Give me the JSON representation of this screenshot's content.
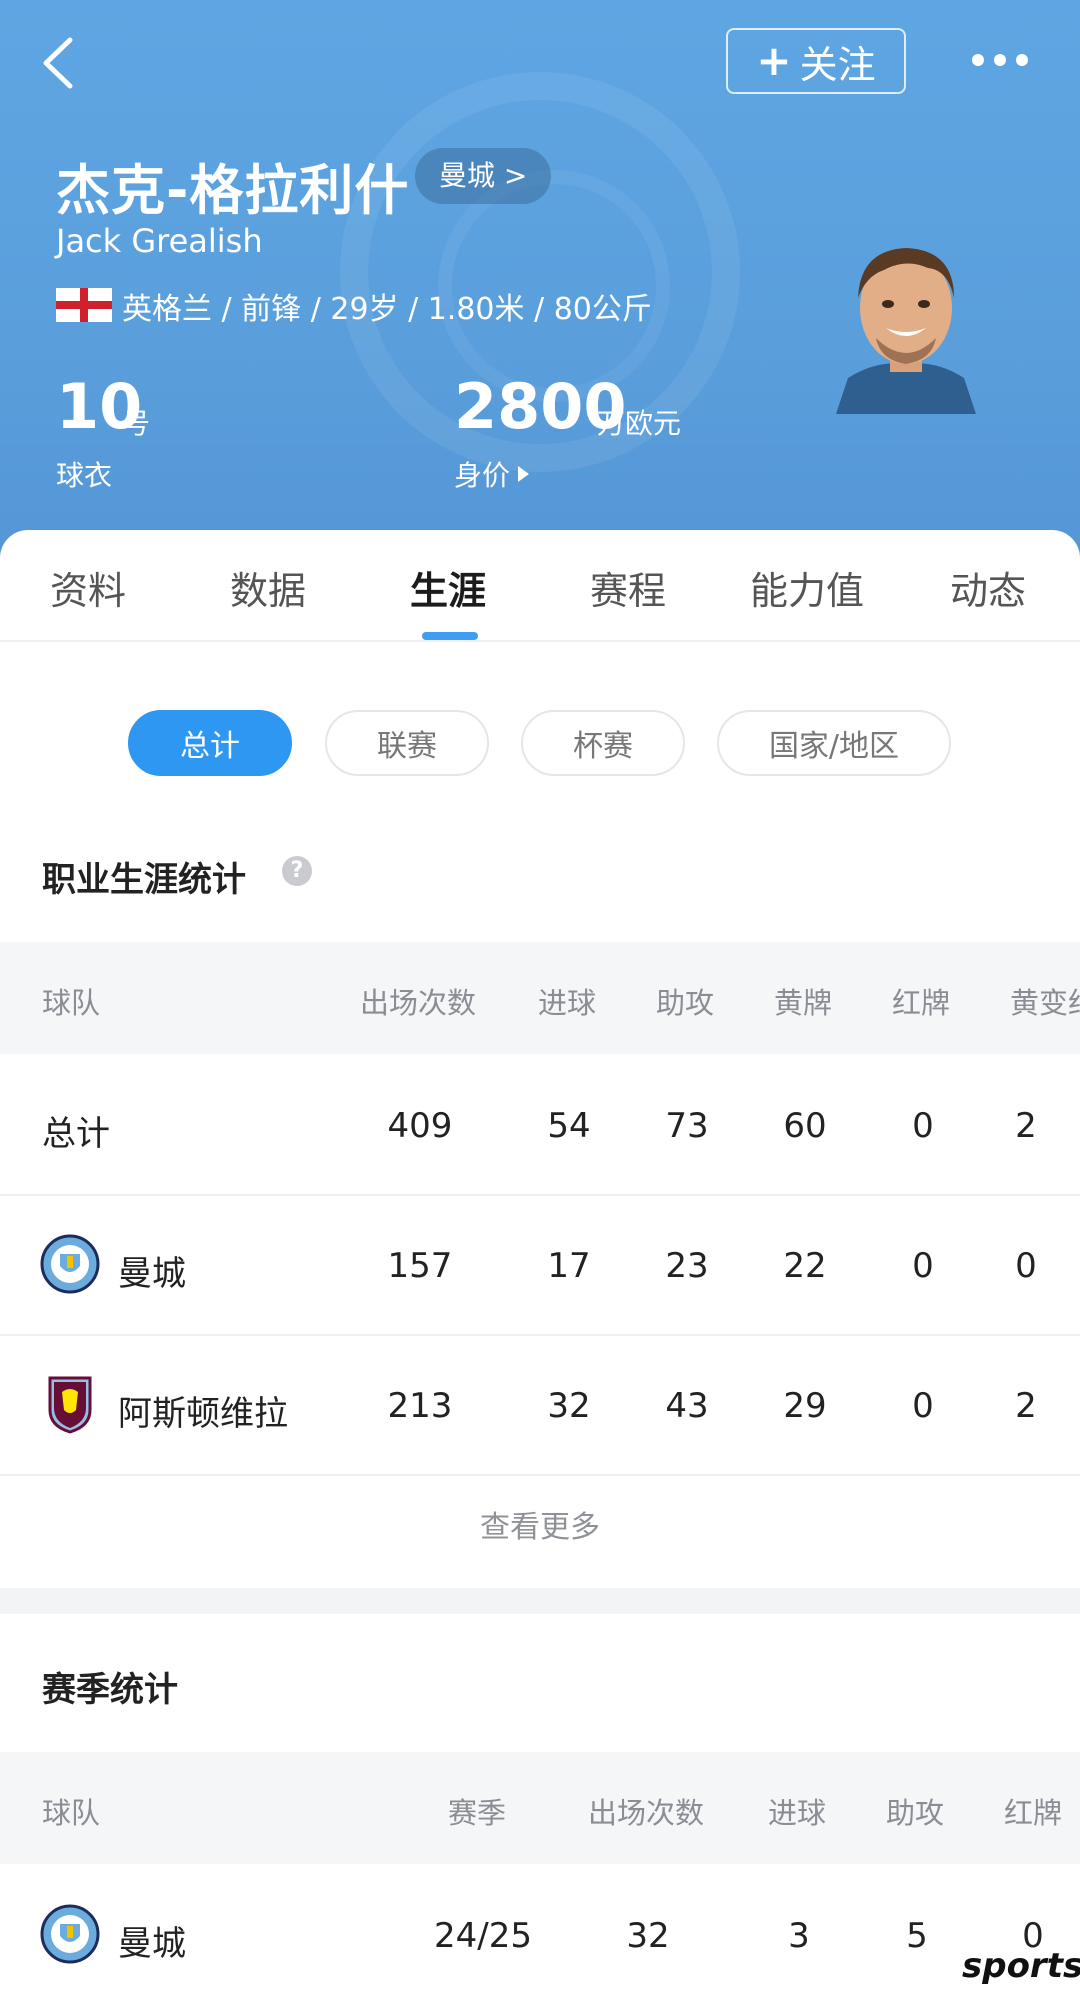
{
  "header": {
    "follow_label": "关注",
    "player_name": "杰克-格拉利什",
    "club_pill": "曼城 >",
    "player_name_en": "Jack Grealish",
    "player_info": "英格兰 / 前锋 / 29岁 / 1.80米 / 80公斤",
    "shirt_number": "10",
    "shirt_unit": "号",
    "shirt_label": "球衣",
    "market_value": "2800",
    "market_value_unit": "万欧元",
    "market_value_label": "身价"
  },
  "tabs": [
    {
      "label": "资料"
    },
    {
      "label": "数据"
    },
    {
      "label": "生涯",
      "active": true
    },
    {
      "label": "赛程"
    },
    {
      "label": "能力值"
    },
    {
      "label": "动态"
    }
  ],
  "filters": [
    {
      "label": "总计",
      "active": true
    },
    {
      "label": "联赛"
    },
    {
      "label": "杯赛"
    },
    {
      "label": "国家/地区"
    }
  ],
  "career": {
    "title": "职业生涯统计",
    "headers": [
      "球队",
      "出场次数",
      "进球",
      "助攻",
      "黄牌",
      "红牌",
      "黄变红"
    ],
    "rows": [
      {
        "team": "总计",
        "apps": "409",
        "goals": "54",
        "assists": "73",
        "yellow": "60",
        "red": "0",
        "second_yellow": "2"
      },
      {
        "team": "曼城",
        "apps": "157",
        "goals": "17",
        "assists": "23",
        "yellow": "22",
        "red": "0",
        "second_yellow": "0"
      },
      {
        "team": "阿斯顿维拉",
        "apps": "213",
        "goals": "32",
        "assists": "43",
        "yellow": "29",
        "red": "0",
        "second_yellow": "2"
      }
    ],
    "see_more": "查看更多"
  },
  "season": {
    "title": "赛季统计",
    "headers": [
      "球队",
      "赛季",
      "出场次数",
      "进球",
      "助攻",
      "红牌"
    ],
    "rows": [
      {
        "team": "曼城",
        "season": "24/25",
        "apps": "32",
        "goals": "3",
        "assists": "5",
        "red": "0"
      }
    ]
  },
  "watermark": "sports",
  "colors": {
    "header_blue": "#5ea6e3",
    "accent_blue": "#2e97f2",
    "table_head_bg": "#f5f6f8"
  },
  "icons": [
    "back-arrow-icon",
    "plus-icon",
    "more-dots-icon",
    "england-flag-icon",
    "triangle-right-icon",
    "help-icon",
    "man-city-crest-icon",
    "aston-villa-crest-icon"
  ]
}
